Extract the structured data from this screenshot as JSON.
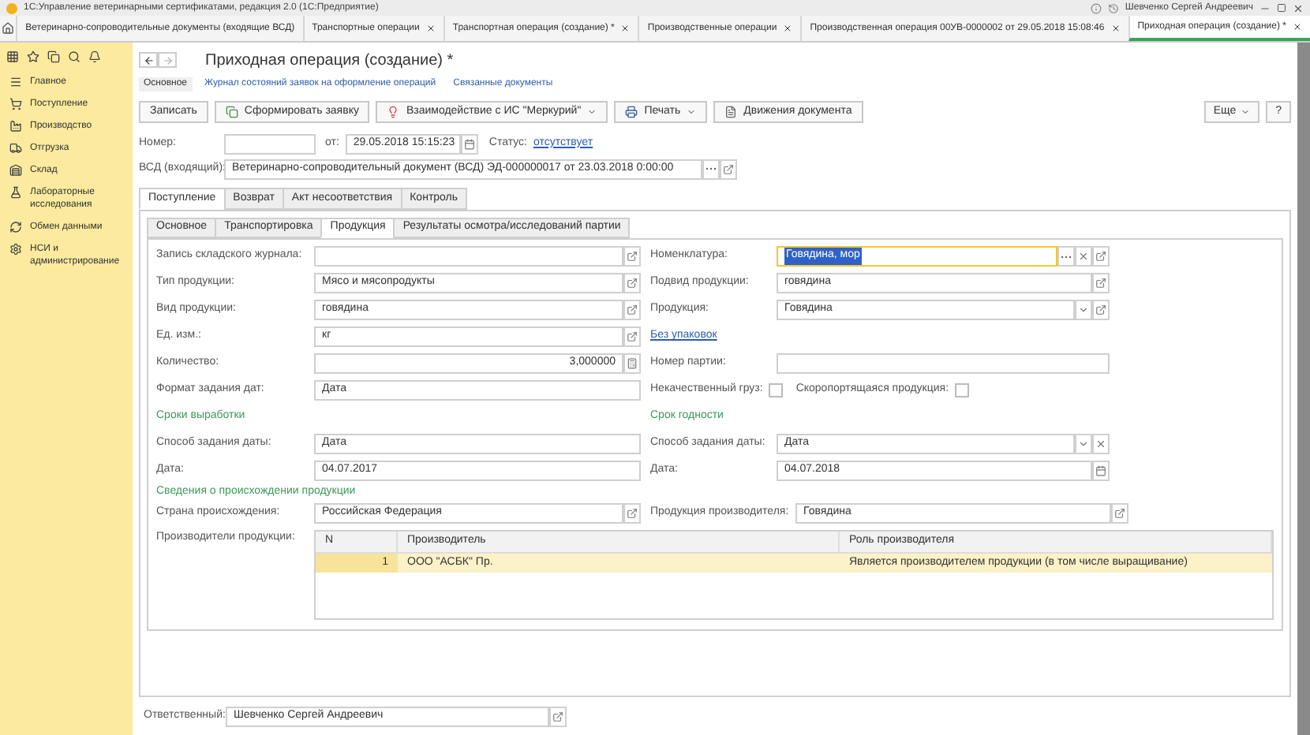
{
  "app_title": "1С:Управление ветеринарными сертификатами, редакция 2.0 (1С:Предприятие)",
  "user": "Шевченко Сергей Андреевич",
  "open_tabs": [
    {
      "label": "Ветеринарно-сопроводительные документы (входящие ВСД)",
      "selected": false,
      "closable": false
    },
    {
      "label": "Транспортные операции",
      "selected": false,
      "closable": true
    },
    {
      "label": "Транспортная операция (создание) *",
      "selected": false,
      "closable": true
    },
    {
      "label": "Производственные операции",
      "selected": false,
      "closable": true
    },
    {
      "label": "Производственная операция 00УВ-0000002 от 29.05.2018 15:08:46",
      "selected": false,
      "closable": true
    },
    {
      "label": "Приходная операция (создание) *",
      "selected": true,
      "closable": true
    }
  ],
  "sidebar": {
    "items": [
      {
        "label": "Главное",
        "kind": "menu"
      },
      {
        "label": "Поступление",
        "kind": "cart"
      },
      {
        "label": "Производство",
        "kind": "factory"
      },
      {
        "label": "Отгрузка",
        "kind": "truck"
      },
      {
        "label": "Склад",
        "kind": "warehouse"
      },
      {
        "label": "Лабораторные исследования",
        "kind": "flask"
      },
      {
        "label": "Обмен данными",
        "kind": "exchange"
      },
      {
        "label": "НСИ и администрирование",
        "kind": "gear"
      }
    ]
  },
  "form": {
    "title": "Приходная операция (создание) *",
    "nav_links": [
      {
        "label": "Основное",
        "selected": true
      },
      {
        "label": "Журнал состояний заявок на оформление операций",
        "selected": false
      },
      {
        "label": "Связанные документы",
        "selected": false
      }
    ],
    "toolbar": [
      {
        "label": "Записать",
        "kind": "plain"
      },
      {
        "label": "Сформировать заявку",
        "kind": "request"
      },
      {
        "label": "Взаимодействие с ИС \"Меркурий\"",
        "kind": "mercury"
      },
      {
        "label": "Печать",
        "kind": "print"
      },
      {
        "label": "Движения документа",
        "kind": "movements"
      }
    ],
    "toolbar_right": [
      {
        "label": "Еще",
        "kind": "more"
      },
      {
        "label": "?",
        "kind": "help"
      }
    ],
    "number": {
      "label": "Номер:"
    },
    "date": {
      "label": "от:",
      "value": "29.05.2018 15:15:23"
    },
    "status": {
      "label": "Статус:",
      "value": "отсутствует"
    },
    "vsd": {
      "label": "ВСД (входящий):",
      "value": "Ветеринарно-сопроводительный документ (ВСД) ЭД-000000017 от 23.03.2018 0:00:00"
    },
    "tabs": [
      {
        "label": "Поступление",
        "selected": true
      },
      {
        "label": "Возврат",
        "selected": false
      },
      {
        "label": "Акт несоответствия",
        "selected": false
      },
      {
        "label": "Контроль",
        "selected": false
      }
    ],
    "subtabs": [
      {
        "label": "Основное",
        "selected": false
      },
      {
        "label": "Транспортировка",
        "selected": false
      },
      {
        "label": "Продукция",
        "selected": true
      },
      {
        "label": "Результаты осмотра/исследований партии",
        "selected": false
      }
    ],
    "left_rows": [
      {
        "kind": "reference",
        "label": "Запись складского журнала:"
      },
      {
        "kind": "reference",
        "label": "Тип продукции:",
        "value": "Мясо и мясопродукты"
      },
      {
        "kind": "reference",
        "label": "Вид продукции:",
        "value": "говядина"
      },
      {
        "kind": "reference",
        "label": "Ед. изм.:",
        "value": "кг"
      },
      {
        "kind": "number",
        "label": "Количество:",
        "value": "3,000000"
      },
      {
        "kind": "text",
        "label": "Формат задания дат:",
        "value": "Дата"
      },
      {
        "kind": "section",
        "label": "Сроки выработки"
      },
      {
        "kind": "text",
        "label": "Способ задания даты:",
        "value": "Дата"
      },
      {
        "kind": "text",
        "label": "Дата:",
        "value": "04.07.2017"
      }
    ],
    "right_rows": [
      {
        "kind": "picker",
        "label": "Номенклатура:",
        "value": "Говядина, мор",
        "focused": true
      },
      {
        "kind": "reference",
        "label": "Подвид продукции:",
        "value": "говядина",
        "focused": false
      },
      {
        "kind": "choice",
        "label": "Продукция:",
        "value": "Говядина",
        "focused": false
      },
      {
        "kind": "link",
        "label": "Без упаковок"
      },
      {
        "kind": "text",
        "label": "Номер партии:",
        "focused": false
      },
      {
        "kind": "checks",
        "items": [
          {
            "label": "Некачественный груз:",
            "checked": false
          },
          {
            "label": "Скоропортящаяся продукция:",
            "checked": false
          }
        ]
      },
      {
        "kind": "section",
        "label": "Срок годности"
      },
      {
        "kind": "enum",
        "label": "Способ задания даты:",
        "value": "Дата",
        "focused": false
      },
      {
        "kind": "date",
        "label": "Дата:",
        "value": "04.07.2018",
        "focused": false
      }
    ],
    "origin_section": "Сведения о происхождении продукции",
    "country": {
      "label": "Страна происхождения:",
      "value": "Российская Федерация"
    },
    "producer_product": {
      "label": "Продукция производителя:",
      "value": "Говядина"
    },
    "producers": {
      "label": "Производители продукции:",
      "columns": [
        "N",
        "Производитель",
        "Роль производителя"
      ],
      "rows": [
        {
          "cells": [
            "1",
            "ООО \"АСБК\" Пр.",
            "Является производителем продукции (в том числе выращивание)"
          ],
          "selected": true
        }
      ]
    },
    "responsible": {
      "label": "Ответственный:",
      "value": "Шевченко Сергей Андреевич"
    }
  }
}
